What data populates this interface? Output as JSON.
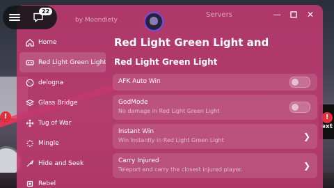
{
  "window": {
    "author_text": "by Moondiety",
    "tab_right": "Servers"
  },
  "chat": {
    "badge_count": "22"
  },
  "sidebar": {
    "items": [
      {
        "label": "Home",
        "icon": "home-icon"
      },
      {
        "label": "Red Light Green Light and",
        "icon": "traffic-icon"
      },
      {
        "label": "delogna",
        "icon": "cookie-icon"
      },
      {
        "label": "Glass Bridge",
        "icon": "layers-icon"
      },
      {
        "label": "Tug of War",
        "icon": "move-icon"
      },
      {
        "label": "Mingle",
        "icon": "loader-icon"
      },
      {
        "label": "Hide and Seek",
        "icon": "knife-icon"
      },
      {
        "label": "Rebel",
        "icon": "cpu-icon"
      }
    ]
  },
  "content": {
    "title": "Red Light Green Light and",
    "section": "Red Light Green Light",
    "options": [
      {
        "title": "AFK Auto Win",
        "desc": "",
        "control": "toggle",
        "on": false
      },
      {
        "title": "GodMode",
        "desc": "No damage in Red Light Green Light",
        "control": "toggle",
        "on": false
      },
      {
        "title": "Instant Win",
        "desc": "Win Instantly in Red Light Green Light",
        "control": "chevron"
      },
      {
        "title": "Carry Injured",
        "desc": "Teleport and carry the closest injured player.",
        "control": "chevron"
      }
    ]
  },
  "game": {
    "hud_text_right": "ext",
    "hud_alert": "!"
  },
  "colors": {
    "window_bg": "#bc3a6e",
    "avatar_ring": "#6b4df0"
  }
}
